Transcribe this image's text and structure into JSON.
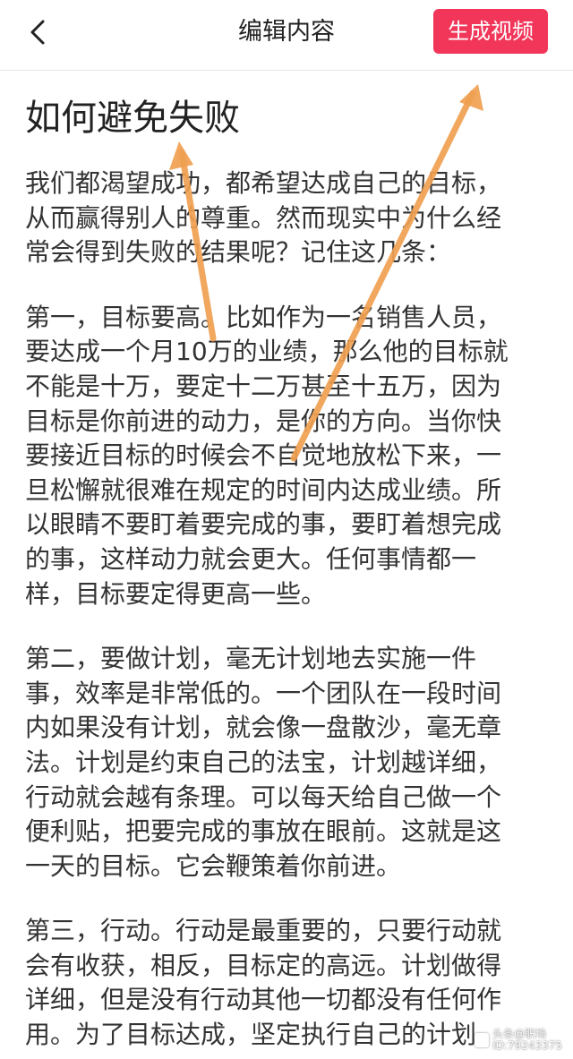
{
  "header": {
    "title": "编辑内容",
    "generate_label": "生成视频",
    "back_icon": "chevron-left-icon"
  },
  "article": {
    "title": "如何避免失败",
    "paragraphs": [
      "我们都渴望成功，都希望达成自己的目标，\n从而赢得别人的尊重。然而现实中为什么经\n常会得到失败的结果呢？记住这几条：",
      "第一，目标要高。比如作为一名销售人员，\n要达成一个月10万的业绩，那么他的目标就\n不能是十万，要定十二万甚至十五万，因为\n目标是你前进的动力，是你的方向。当你快\n要接近目标的时候会不自觉地放松下来，一\n旦松懈就很难在规定的时间内达成业绩。所\n以眼睛不要盯着要完成的事，要盯着想完成\n的事，这样动力就会更大。任何事情都一\n样，目标要定得更高一些。",
      "第二，要做计划，毫无计划地去实施一件\n事，效率是非常低的。一个团队在一段时间\n内如果没有计划，就会像一盘散沙，毫无章\n法。计划是约束自己的法宝，计划越详细，\n行动就会越有条理。可以每天给自己做一个\n便利贴，把要完成的事放在眼前。这就是这\n一天的目标。它会鞭策着你前进。",
      "第三，行动。行动是最重要的，只要行动就\n会有收获，相反，目标定的高远。计划做得\n详细，但是没有行动其他一切都没有任何作\n用。为了目标达成，坚定执行自己的计划"
    ]
  },
  "watermark": {
    "line1": "头条@职场",
    "line2": "ID:79243375"
  },
  "colors": {
    "accent": "#f2365a",
    "arrow": "#f0a050"
  }
}
